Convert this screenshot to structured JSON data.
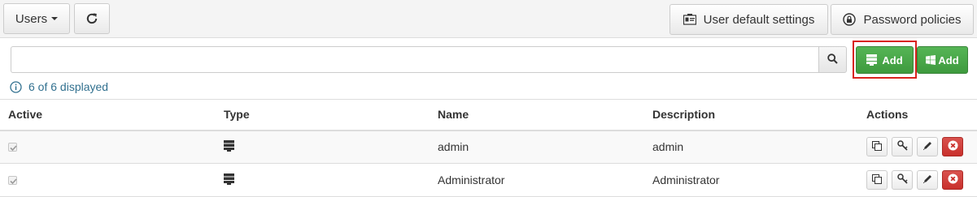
{
  "toolbar": {
    "users_label": "Users",
    "refresh_icon": "refresh-icon",
    "user_defaults_label": "User default settings",
    "user_defaults_icon": "id-card-icon",
    "password_policies_label": "Password policies",
    "password_policies_icon": "lock-icon"
  },
  "search": {
    "value": "",
    "placeholder": "",
    "button_icon": "search-icon"
  },
  "add_buttons": [
    {
      "label": "Add",
      "icon": "server-icon",
      "highlighted": true
    },
    {
      "label": "Add",
      "icon": "windows-icon",
      "highlighted": false
    }
  ],
  "status": {
    "icon": "info-icon",
    "text": "6 of 6 displayed"
  },
  "colors": {
    "accent_green": "#47a447",
    "danger_red": "#d9534f",
    "highlight_border": "#d9231e",
    "info_text": "#31708f"
  },
  "table": {
    "columns": [
      "Active",
      "Type",
      "Name",
      "Description",
      "Actions"
    ],
    "rows": [
      {
        "active": true,
        "type_icon": "server-icon",
        "name": "admin",
        "description": "admin"
      },
      {
        "active": true,
        "type_icon": "server-icon",
        "name": "Administrator",
        "description": "Administrator"
      }
    ],
    "row_actions": [
      "copy-icon",
      "key-icon",
      "pencil-icon",
      "delete-icon"
    ]
  }
}
